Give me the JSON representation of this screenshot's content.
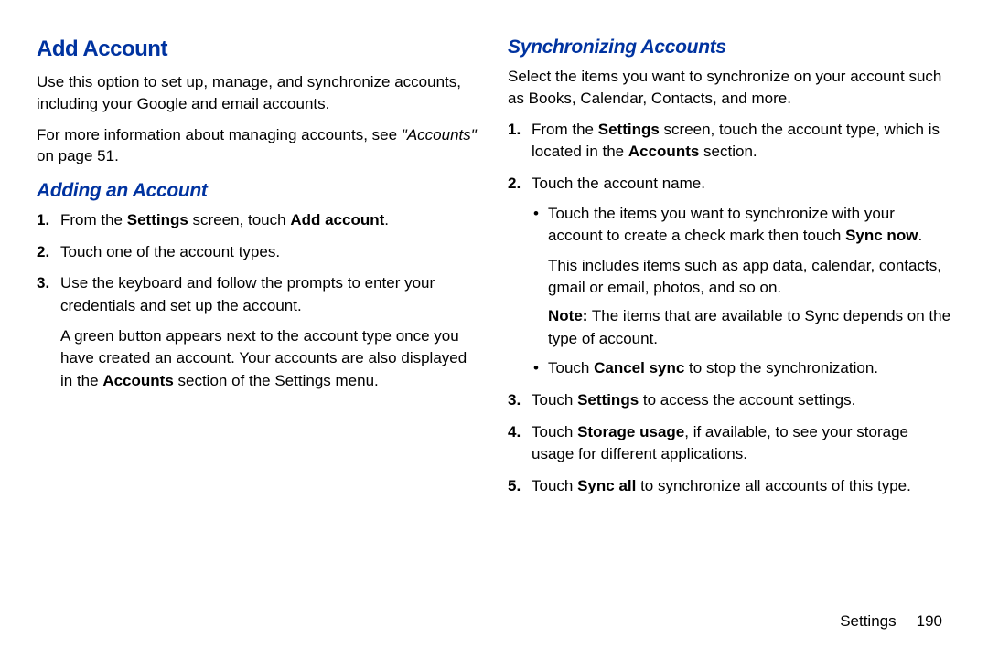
{
  "left": {
    "h1": "Add Account",
    "p1": "Use this option to set up, manage, and synchronize accounts, including your Google and email accounts.",
    "p2_a": "For more information about managing accounts, see ",
    "p2_b": "\"Accounts\"",
    "p2_c": " on page 51.",
    "h2": "Adding an Account",
    "li1_a": "From the ",
    "li1_b": "Settings",
    "li1_c": " screen, touch ",
    "li1_d": "Add account",
    "li1_e": ".",
    "li2": "Touch one of the account types.",
    "li3": "Use the keyboard and follow the prompts to enter your credentials and set up the account.",
    "li3_sub_a": "A green button appears next to the account type once you have created an account. Your accounts are also displayed in the ",
    "li3_sub_b": "Accounts",
    "li3_sub_c": " section of the Settings menu."
  },
  "right": {
    "h2": "Synchronizing Accounts",
    "p1": "Select the items you want to synchronize on your account such as Books, Calendar, Contacts, and more.",
    "li1_a": "From the ",
    "li1_b": "Settings",
    "li1_c": " screen, touch the account type, which is located in the ",
    "li1_d": "Accounts",
    "li1_e": " section.",
    "li2": "Touch the account name.",
    "li2_b1_a": "Touch the items you want to synchronize with your account to create a check mark then touch ",
    "li2_b1_b": "Sync now",
    "li2_b1_c": ".",
    "li2_b1_sub": "This includes items such as app data, calendar, contacts, gmail or email, photos, and so on.",
    "li2_b1_note_a": "Note:",
    "li2_b1_note_b": " The items that are available to Sync depends on the type of account.",
    "li2_b2_a": "Touch ",
    "li2_b2_b": "Cancel sync",
    "li2_b2_c": " to stop the synchronization.",
    "li3_a": "Touch ",
    "li3_b": "Settings",
    "li3_c": " to access the account settings.",
    "li4_a": "Touch ",
    "li4_b": "Storage usage",
    "li4_c": ", if available, to see your storage usage for different applications.",
    "li5_a": "Touch ",
    "li5_b": "Sync all",
    "li5_c": " to synchronize all accounts of this type."
  },
  "footer": {
    "section": "Settings",
    "page": "190"
  }
}
